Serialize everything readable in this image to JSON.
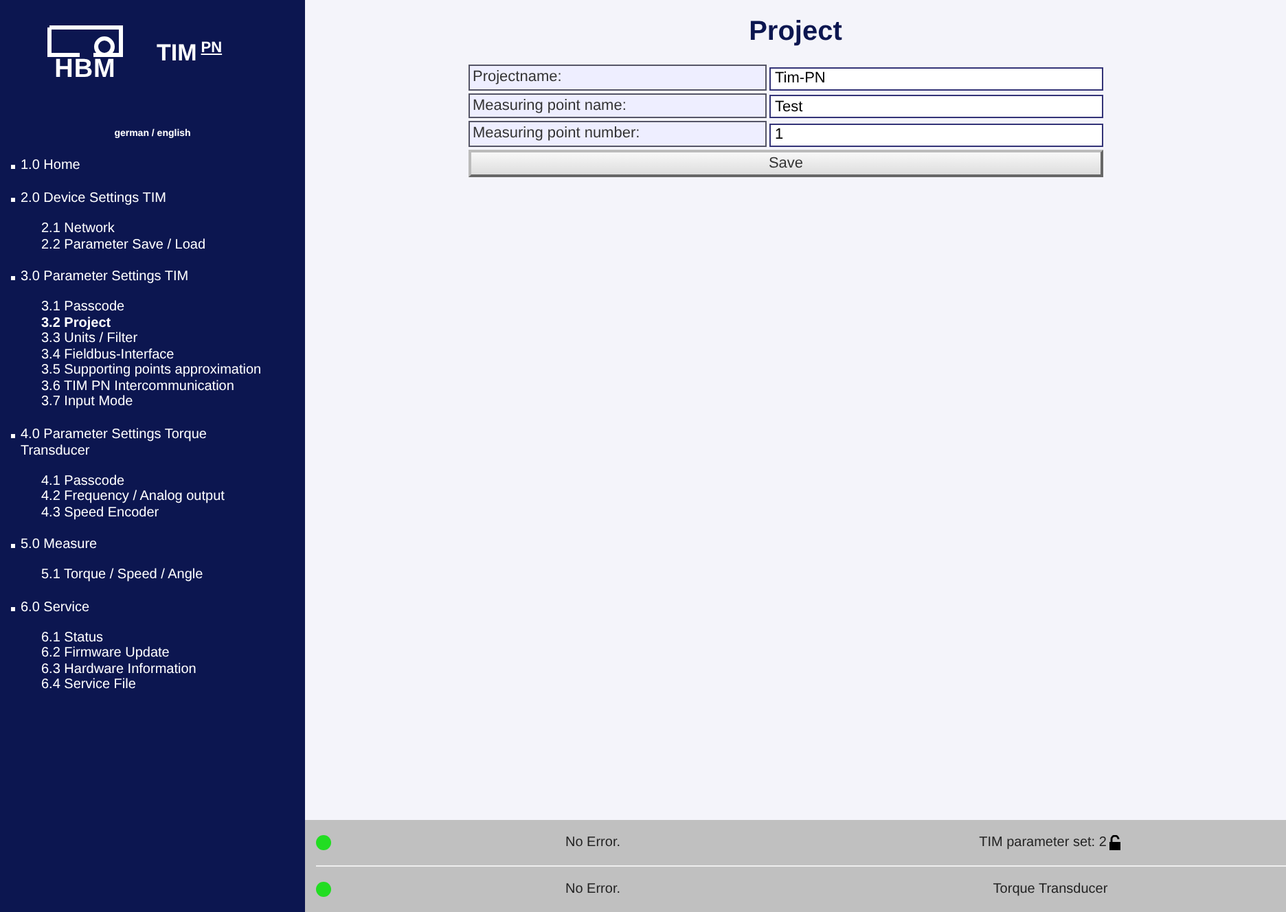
{
  "logo": {
    "brand": "HBM",
    "product": "TIM",
    "product_suffix": "PN"
  },
  "language_links": "german / english",
  "nav": [
    {
      "label": "1.0 Home"
    },
    {
      "label": "2.0 Device Settings TIM",
      "children": [
        {
          "label": "2.1 Network",
          "selected": false
        },
        {
          "label": "2.2 Parameter Save / Load",
          "selected": false
        }
      ]
    },
    {
      "label": "3.0 Parameter Settings TIM",
      "children": [
        {
          "label": "3.1 Passcode",
          "selected": false
        },
        {
          "label": "3.2 Project",
          "selected": true
        },
        {
          "label": "3.3 Units / Filter",
          "selected": false
        },
        {
          "label": "3.4 Fieldbus-Interface",
          "selected": false
        },
        {
          "label": "3.5 Supporting points approximation",
          "selected": false
        },
        {
          "label": "3.6 TIM PN Intercommunication",
          "selected": false
        },
        {
          "label": "3.7 Input Mode",
          "selected": false
        }
      ]
    },
    {
      "label": "4.0 Parameter Settings Torque Transducer",
      "children": [
        {
          "label": "4.1 Passcode",
          "selected": false
        },
        {
          "label": "4.2 Frequency / Analog output",
          "selected": false
        },
        {
          "label": "4.3 Speed Encoder",
          "selected": false
        }
      ]
    },
    {
      "label": "5.0 Measure",
      "children": [
        {
          "label": "5.1 Torque / Speed / Angle",
          "selected": false
        }
      ]
    },
    {
      "label": "6.0 Service",
      "children": [
        {
          "label": "6.1 Status",
          "selected": false
        },
        {
          "label": "6.2 Firmware Update",
          "selected": false
        },
        {
          "label": "6.3 Hardware Information",
          "selected": false
        },
        {
          "label": "6.4 Service File",
          "selected": false
        }
      ]
    }
  ],
  "page_title": "Project",
  "form": {
    "fields": [
      {
        "label": "Projectname:",
        "value": "Tim-PN"
      },
      {
        "label": "Measuring point name:",
        "value": "Test"
      },
      {
        "label": "Measuring point number:",
        "value": "1"
      }
    ],
    "button": "Save"
  },
  "status_rows": [
    {
      "color": "#22dd22",
      "message": "No Error.",
      "info": "TIM parameter set: 2",
      "locked": false
    },
    {
      "color": "#22dd22",
      "message": "No Error.",
      "info": "Torque Transducer"
    }
  ]
}
